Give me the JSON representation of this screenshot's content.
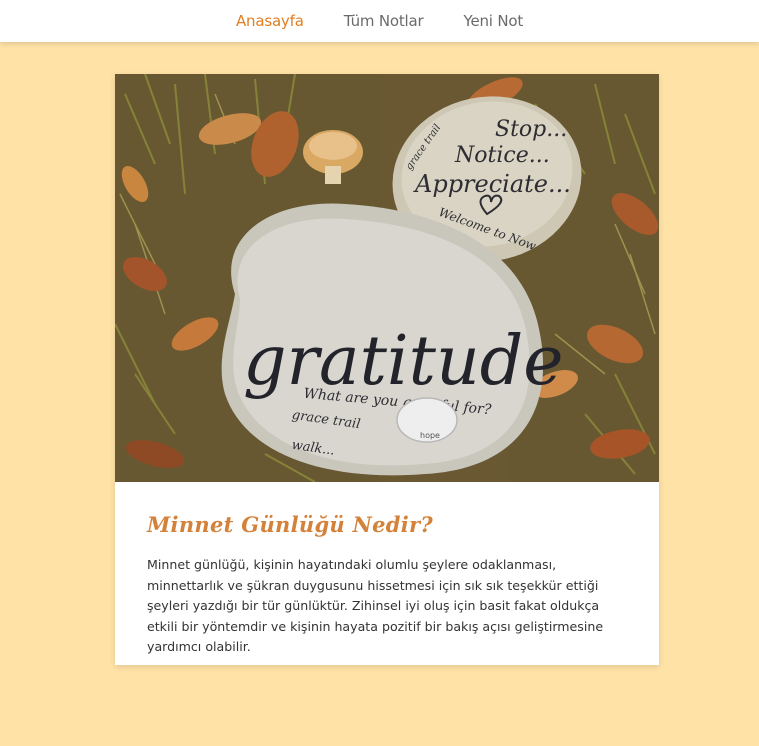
{
  "nav": {
    "items": [
      {
        "label": "Anasayfa",
        "active": true
      },
      {
        "label": "Tüm Notlar",
        "active": false
      },
      {
        "label": "Yeni Not",
        "active": false
      }
    ]
  },
  "card": {
    "image": {
      "big_stone_word": "gratitude",
      "big_stone_question": "What are you grateful for?",
      "big_stone_trail": "grace trail",
      "big_stone_walk": "walk...",
      "small_stone_line1": "Stop...",
      "small_stone_line2": "Notice...",
      "small_stone_line3": "Appreciate...",
      "small_stone_line4": "Welcome to Now",
      "small_stone_corner": "grace trail",
      "pebble_text": "hope"
    },
    "title": "Minnet Günlüğü Nedir?",
    "body": "Minnet günlüğü, kişinin hayatındaki olumlu şeylere odaklanması, minnettarlık ve şükran duygusunu hissetmesi için sık sık teşekkür ettiği şeyleri yazdığı bir tür günlüktür. Zihinsel iyi oluş için basit fakat oldukça etkili bir yöntemdir ve kişinin hayata pozitif bir bakış açısı geliştirmesine yardımcı olabilir."
  },
  "colors": {
    "page_background": "#ffe2a6",
    "accent": "#e07e23",
    "nav_text": "#6b6b6b",
    "title": "#d4813a"
  }
}
